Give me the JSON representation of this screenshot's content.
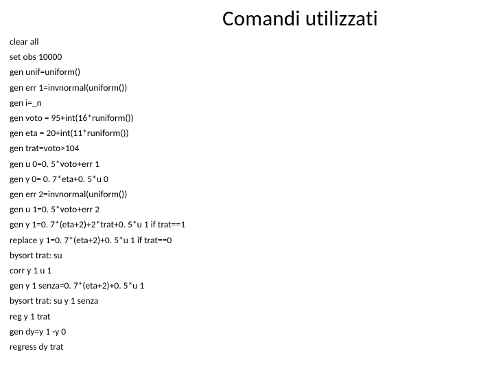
{
  "title": "Comandi utilizzati",
  "lines": {
    "l0": "clear all",
    "l1": "set obs 10000",
    "l2": "gen unif=uniform()",
    "l3": "gen err 1=invnormal(uniform())",
    "l4": "gen i=_n",
    "l5": "gen voto = 95+int(16*runiform())",
    "l6": "gen eta = 20+int(11*runiform())",
    "l7": "gen trat=voto>104",
    "l8": "gen u 0=0. 5*voto+err 1",
    "l9": "gen y 0= 0. 7*eta+0. 5*u 0",
    "l10": "gen err 2=invnormal(uniform())",
    "l11": "gen u 1=0. 5*voto+err 2",
    "l12": "gen y 1=0. 7*(eta+2)+2*trat+0. 5*u 1 if trat==1",
    "l13": "replace y 1=0. 7*(eta+2)+0. 5*u 1 if trat==0",
    "l14": "bysort trat: su",
    "l15": "corr y 1 u 1",
    "l16": "gen y 1 senza=0. 7*(eta+2)+0. 5*u 1",
    "l17": "bysort trat: su y 1 senza",
    "l18": "reg y 1 trat",
    "l19": "gen dy=y 1 -y 0",
    "l20": "regress dy trat"
  }
}
